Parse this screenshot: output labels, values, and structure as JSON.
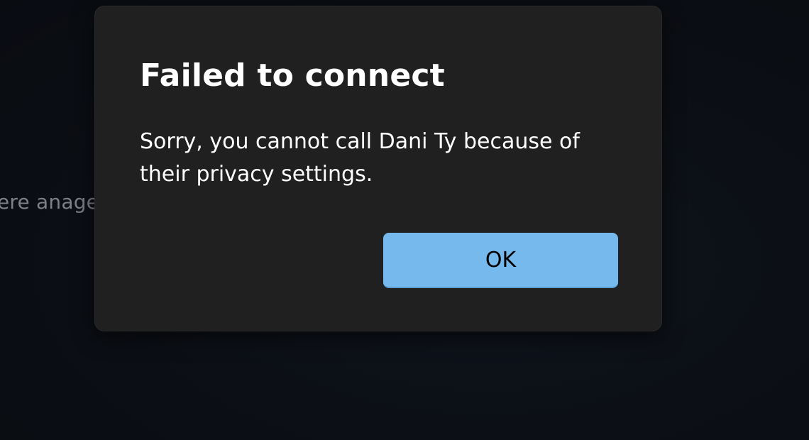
{
  "background": {
    "partial_text": "ere anage"
  },
  "dialog": {
    "title": "Failed to connect",
    "message": "Sorry, you cannot call Dani Ty because of their privacy settings.",
    "ok_label": "OK"
  },
  "colors": {
    "dialog_bg": "#202020",
    "accent": "#76b9ed",
    "page_bg": "#0b0f15"
  }
}
